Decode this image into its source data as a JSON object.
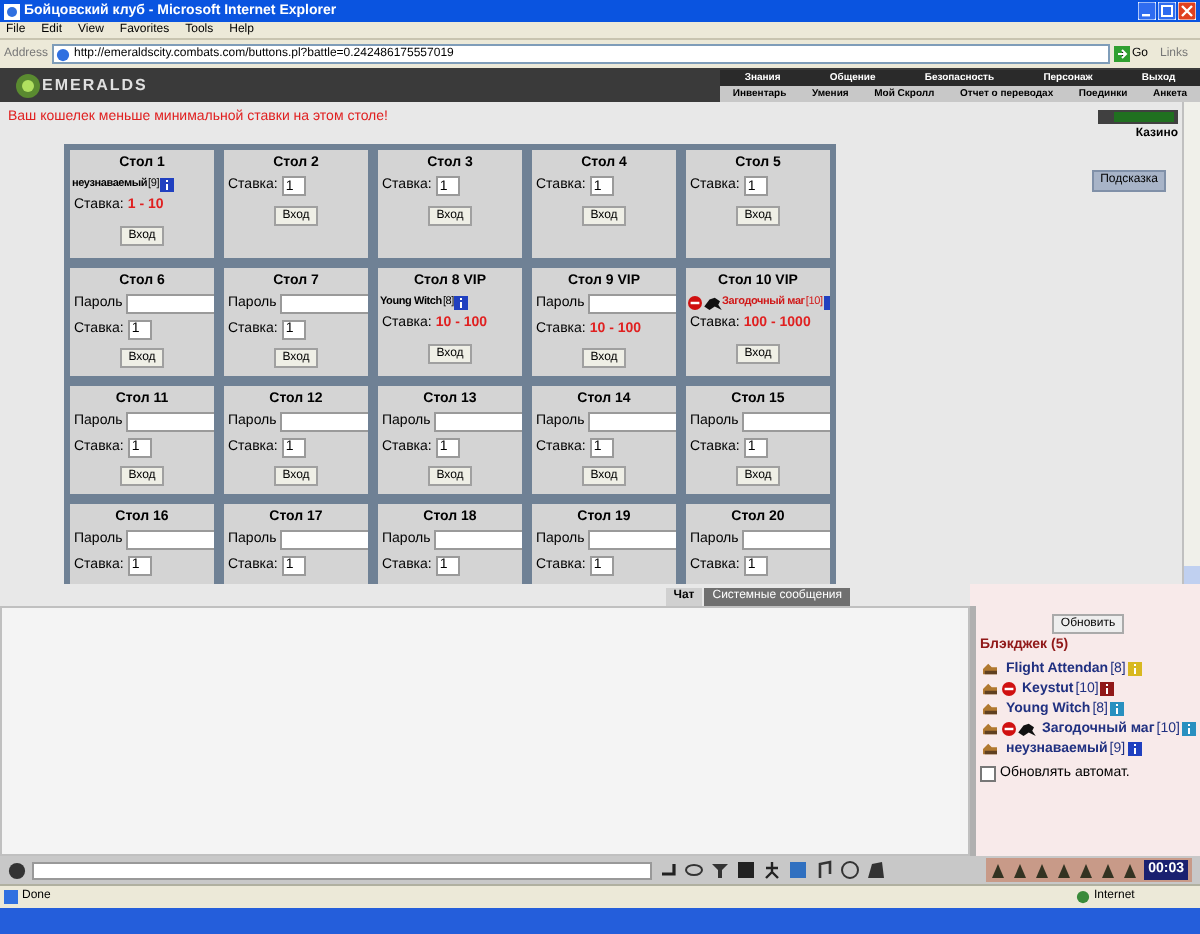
{
  "window": {
    "title": "Бойцовский клуб - Microsoft Internet Explorer"
  },
  "menu": [
    "File",
    "Edit",
    "View",
    "Favorites",
    "Tools",
    "Help"
  ],
  "address_bar": {
    "label": "Address",
    "url": "http://emeraldscity.combats.com/buttons.pl?battle=0.242486175557019",
    "go": "Go",
    "links": "Links"
  },
  "site_header": {
    "logo": "EMERALDS",
    "nav_top": [
      "Знания",
      "Общение",
      "Безопасность",
      "Персонаж",
      "Выход"
    ],
    "nav_bottom": [
      "Инвентарь",
      "Умения",
      "Мой Скролл",
      "Отчет о переводах",
      "Поединки",
      "Анкета"
    ]
  },
  "message": "Ваш кошелек меньше минимальной ставки на этом столе!",
  "sidebar": {
    "casino_link": "Казино",
    "hint_button": "Подсказка"
  },
  "tables": [
    {
      "title": "Стол 1",
      "player": {
        "name": "неузнаваемый",
        "level": "[9]",
        "highlighted": false,
        "badge": {
          "color": "#2040c0"
        }
      },
      "stake_label": "Ставка:",
      "stake_range": "1 - 10",
      "button": "Вход"
    },
    {
      "title": "Стол 2",
      "stake_label": "Ставка:",
      "stake_input": "1",
      "button": "Вход"
    },
    {
      "title": "Стол 3",
      "stake_label": "Ставка:",
      "stake_input": "1",
      "button": "Вход"
    },
    {
      "title": "Стол 4",
      "stake_label": "Ставка:",
      "stake_input": "1",
      "button": "Вход"
    },
    {
      "title": "Стол 5",
      "stake_label": "Ставка:",
      "stake_input": "1",
      "button": "Вход"
    },
    {
      "title": "Стол 6",
      "password_label": "Пароль",
      "stake_label": "Ставка:",
      "stake_input": "1",
      "button": "Вход"
    },
    {
      "title": "Стол 7",
      "password_label": "Пароль",
      "stake_label": "Ставка:",
      "stake_input": "1",
      "button": "Вход"
    },
    {
      "title": "Стол 8 VIP",
      "player": {
        "name": "Young Witch",
        "level": "[8]",
        "highlighted": false,
        "badge": {
          "color": "#2040c0"
        }
      },
      "stake_label": "Ставка:",
      "stake_range": "10 - 100",
      "button": "Вход"
    },
    {
      "title": "Стол 9 VIP",
      "password_label": "Пароль",
      "stake_label": "Ставка:",
      "stake_range": "10 - 100",
      "button": "Вход"
    },
    {
      "title": "Стол 10 VIP",
      "player": {
        "name": "Загодочный маг",
        "level": "[10]",
        "highlighted": true,
        "badge": {
          "color": "#2040c0"
        },
        "marks": [
          {
            "kind": "forbidden"
          },
          {
            "kind": "beast"
          }
        ]
      },
      "stake_label": "Ставка:",
      "stake_range": "100 - 1000",
      "button": "Вход"
    },
    {
      "title": "Стол 11",
      "password_label": "Пароль",
      "stake_label": "Ставка:",
      "stake_input": "1",
      "button": "Вход"
    },
    {
      "title": "Стол 12",
      "password_label": "Пароль",
      "stake_label": "Ставка:",
      "stake_input": "1",
      "button": "Вход"
    },
    {
      "title": "Стол 13",
      "password_label": "Пароль",
      "stake_label": "Ставка:",
      "stake_input": "1",
      "button": "Вход"
    },
    {
      "title": "Стол 14",
      "password_label": "Пароль",
      "stake_label": "Ставка:",
      "stake_input": "1",
      "button": "Вход"
    },
    {
      "title": "Стол 15",
      "password_label": "Пароль",
      "stake_label": "Ставка:",
      "stake_input": "1",
      "button": "Вход"
    },
    {
      "title": "Стол 16",
      "password_label": "Пароль",
      "stake_label": "Ставка:",
      "stake_input": "1"
    },
    {
      "title": "Стол 17",
      "password_label": "Пароль",
      "stake_label": "Ставка:",
      "stake_input": "1"
    },
    {
      "title": "Стол 18",
      "password_label": "Пароль",
      "stake_label": "Ставка:",
      "stake_input": "1"
    },
    {
      "title": "Стол 19",
      "password_label": "Пароль",
      "stake_label": "Ставка:",
      "stake_input": "1"
    },
    {
      "title": "Стол 20",
      "password_label": "Пароль",
      "stake_label": "Ставка:",
      "stake_input": "1"
    }
  ],
  "chat_tabs": [
    {
      "label": "Чат",
      "selected": true
    },
    {
      "label": "Системные сообщения",
      "selected": false
    }
  ],
  "room_panel": {
    "refresh_button": "Обновить",
    "title": "Блэкджек (5)",
    "players": [
      {
        "name": "Flight Attendan",
        "level": "[8]",
        "badge": {
          "color": "#d8b820"
        },
        "marks": [
          {
            "kind": "cards"
          }
        ]
      },
      {
        "name": "Keystut",
        "level": "[10]",
        "badge": {
          "color": "#901818"
        },
        "marks": [
          {
            "kind": "cards"
          },
          {
            "kind": "forbidden"
          }
        ]
      },
      {
        "name": "Young Witch",
        "level": "[8]",
        "badge": {
          "color": "#2890c0"
        },
        "marks": [
          {
            "kind": "cards"
          }
        ]
      },
      {
        "name": "Загодочный маг",
        "level": "[10]",
        "badge": {
          "color": "#2890c0"
        },
        "marks": [
          {
            "kind": "cards"
          },
          {
            "kind": "forbidden"
          },
          {
            "kind": "beast"
          }
        ]
      },
      {
        "name": "неузнаваемый",
        "level": "[9]",
        "badge": {
          "color": "#2040c0"
        },
        "marks": [
          {
            "kind": "cards"
          }
        ]
      }
    ],
    "auto_refresh": {
      "label": "Обновлять автомат.",
      "checked": false
    }
  },
  "chat_toolbar": {
    "clock": "00:03"
  },
  "status_bar": {
    "status": "Done",
    "zone": "Internet"
  }
}
